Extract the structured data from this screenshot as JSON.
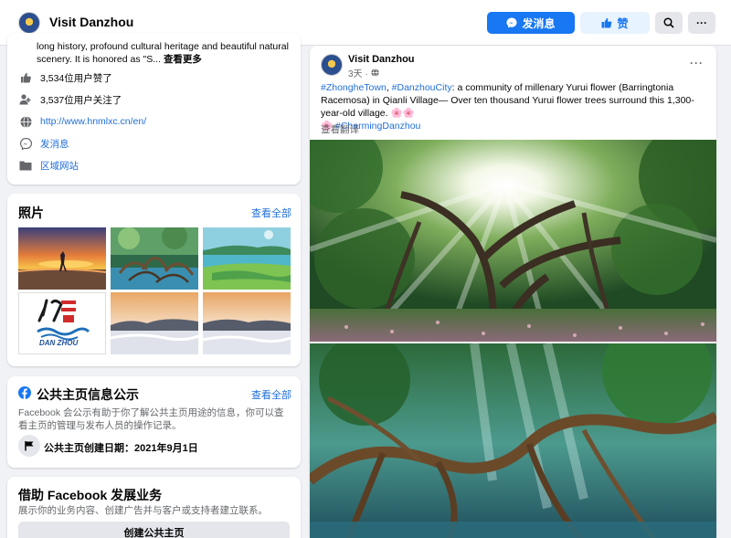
{
  "header": {
    "page_name": "Visit Danzhou",
    "message_button": "发消息",
    "like_button": "赞",
    "more_label": "···"
  },
  "intro": {
    "text": "long history, profound cultural heritage and beautiful natural scenery. It is honored as \"S...",
    "see_more": "查看更多",
    "likes": "3,534位用户赞了",
    "followers": "3,537位用户关注了",
    "website": "http://www.hnmlxc.cn/en/",
    "send_message": "发消息",
    "region_site": "区域网站"
  },
  "photos": {
    "title": "照片",
    "see_all": "查看全部",
    "logo_text": "DAN ZHOU"
  },
  "transparency": {
    "title": "公共主页信息公示",
    "see_all": "查看全部",
    "description": "Facebook 会公示有助于你了解公共主页用途的信息，你可以查看主页的管理与发布人员的操作记录。",
    "created": "公共主页创建日期：2021年9月1日"
  },
  "business": {
    "title": "借助 Facebook 发展业务",
    "description": "展示你的业务内容、创建广告并与客户或支持者建立联系。",
    "create_page_button": "创建公共主页"
  },
  "post": {
    "author": "Visit Danzhou",
    "time": "3天 ·",
    "tag1": "#ZhongheTown",
    "sep": ", ",
    "tag2": "#DanzhouCity",
    "body": ": a community of millenary Yurui flower (Barringtonia Racemosa) in Qianli Village— Over ten thousand Yurui flower trees surround this 1,300-year-old village. 🌸🌸",
    "flower": "🌸 ",
    "tag3": "#CharmingDanzhou",
    "see_translation": "查看翻译",
    "more_label": "···"
  },
  "colors": {
    "brand_blue": "#1877f2",
    "link_blue": "#216fdb",
    "background": "#f0f2f5"
  }
}
